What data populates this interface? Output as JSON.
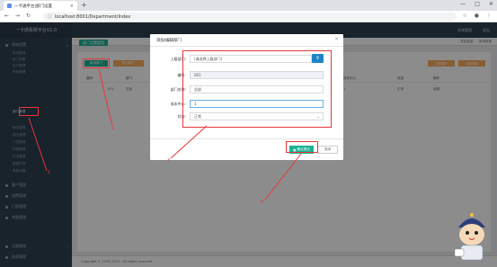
{
  "browser": {
    "tab_title": "一卡通平台|部门设置",
    "url": "localhost:8001/Department/Index",
    "new_tab": "+",
    "win_min": "—",
    "win_max": "□",
    "win_close": "✕"
  },
  "app": {
    "logo": "一卡通系统平台V1.0",
    "header_right": [
      "系统管理",
      "退出"
    ]
  },
  "sidebar": {
    "items": [
      {
        "label": "系统设置",
        "type": "group"
      },
      {
        "label": "系统管理",
        "type": "sub"
      },
      {
        "label": "部门设置",
        "type": "sub"
      },
      {
        "label": "用户管理",
        "type": "sub"
      },
      {
        "label": "角色管理",
        "type": "sub"
      },
      {
        "label": "部门管理",
        "type": "sub",
        "active": true
      },
      {
        "label": "职位管理",
        "type": "sub"
      },
      {
        "label": "岗位管理",
        "type": "sub"
      },
      {
        "label": "人员管理",
        "type": "sub"
      },
      {
        "label": "权限管理",
        "type": "sub"
      },
      {
        "label": "日志管理",
        "type": "sub"
      },
      {
        "label": "数据字典",
        "type": "sub"
      },
      {
        "label": "参数设置",
        "type": "sub"
      },
      {
        "label": "客户管理",
        "type": "group"
      },
      {
        "label": "消费管理",
        "type": "group"
      },
      {
        "label": "门禁管理",
        "type": "group"
      },
      {
        "label": "考勤管理",
        "type": "group"
      },
      {
        "label": "设备管理",
        "type": "group"
      },
      {
        "label": "报表管理",
        "type": "group"
      }
    ]
  },
  "content": {
    "page_tab": "部门设置管理",
    "tabs_right": [
      "关闭全部",
      "关闭其他"
    ],
    "add_button": "新增部门",
    "other_button": "导出部门",
    "right_buttons": [
      "全部展开",
      "全部收缩"
    ],
    "table_headers": [
      "编号",
      "部门",
      "成本中心",
      "状态",
      "操作"
    ],
    "table_row": [
      "001",
      "总部",
      "1",
      "正常",
      "编辑"
    ],
    "footer": "Copyright © 2018-2019 · All rights reserved."
  },
  "modal": {
    "title": "添加/编辑部门",
    "close": "×",
    "fields": [
      {
        "label": "上级部门:",
        "placeholder": "(请选择上级部门)"
      },
      {
        "label": "编号:",
        "value": "001"
      },
      {
        "label": "部门名称:",
        "value": "总部"
      },
      {
        "label": "成本中心:",
        "value": "1"
      },
      {
        "label": "状态:",
        "value": "正常"
      }
    ],
    "save_button": "确认提交",
    "close_button": "关闭"
  },
  "annotations": {
    "numbers": [
      "1",
      "2",
      "3",
      "4"
    ],
    "color": "#e8363a"
  },
  "colors": {
    "primary": "#1ab394",
    "warning": "#f8ac59",
    "sidebar": "#2f4050",
    "info": "#1c84c6"
  }
}
